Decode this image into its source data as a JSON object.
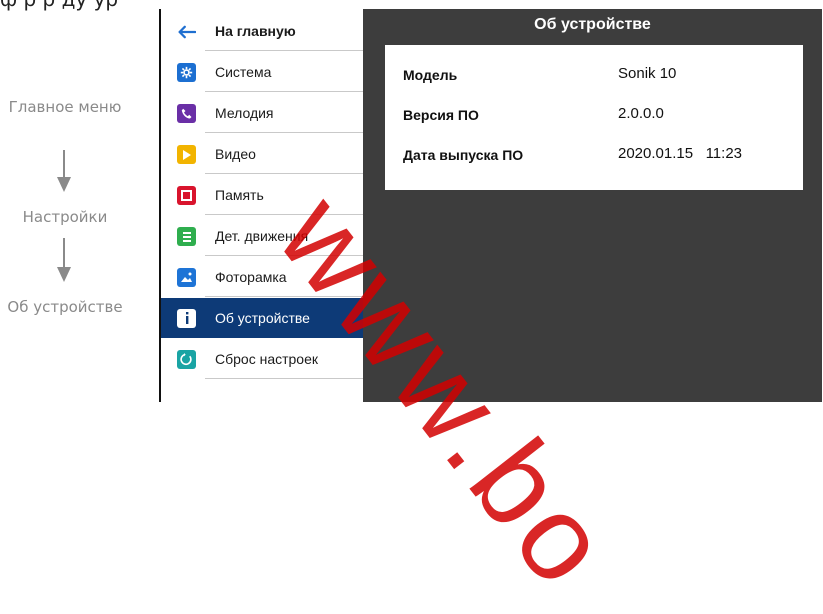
{
  "doc_heading_partial": "ф р р ду ур",
  "flow": {
    "steps": [
      "Главное меню",
      "Настройки",
      "Об устройстве"
    ]
  },
  "sidebar": {
    "back_label": "На главную",
    "items": [
      {
        "label": "Система",
        "icon": "gear-icon",
        "color": "#1c6fd1"
      },
      {
        "label": "Мелодия",
        "icon": "phone-icon",
        "color": "#6a2fa6"
      },
      {
        "label": "Видео",
        "icon": "play-icon",
        "color": "#f2b400"
      },
      {
        "label": "Память",
        "icon": "memory-icon",
        "color": "#d9142d"
      },
      {
        "label": "Дет. движения",
        "icon": "motion-icon",
        "color": "#2fae4e"
      },
      {
        "label": "Фоторамка",
        "icon": "picture-icon",
        "color": "#1e74d6"
      },
      {
        "label": "Об устройстве",
        "icon": "info-icon",
        "color": "#ffffff",
        "active": true
      },
      {
        "label": "Сброс настроек",
        "icon": "reset-icon",
        "color": "#19a4a4"
      }
    ]
  },
  "screen": {
    "title": "Об устройстве",
    "rows": [
      {
        "key": "Модель",
        "value": "Sonik 10"
      },
      {
        "key": "Версия ПО",
        "value": "2.0.0.0"
      },
      {
        "key": "Дата выпуска ПО",
        "value": "2020.01.15   11:23"
      }
    ]
  },
  "watermark": "www.bo",
  "colors": {
    "active": "#0d3a77",
    "device_bg": "#3d3d3d",
    "back_arrow": "#1f6fd0",
    "watermark": "#d20000"
  }
}
